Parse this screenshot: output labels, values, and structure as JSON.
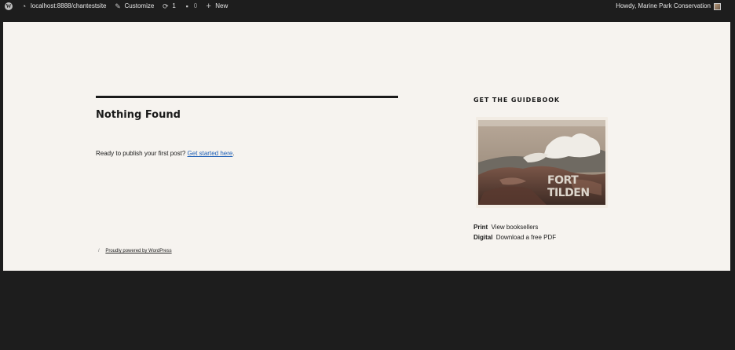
{
  "admin_bar": {
    "site": "localhost:8888/chantestsite",
    "customize": "Customize",
    "updates_count": "1",
    "comments_count": "0",
    "new": "New",
    "howdy": "Howdy, Marine Park Conservation"
  },
  "content": {
    "title": "Nothing Found",
    "intro_text": "Ready to publish your first post? ",
    "intro_link": "Get started here",
    "intro_end": "."
  },
  "footer": {
    "slash": "/",
    "powered_by": "Proudly powered by WordPress"
  },
  "sidebar": {
    "widget_title": "GET THE GUIDEBOOK",
    "book_line1": "FORT",
    "book_line2": "TILDEN",
    "links": [
      {
        "label": "Print",
        "text": "View booksellers"
      },
      {
        "label": "Digital",
        "text": "Download a free PDF"
      }
    ]
  }
}
